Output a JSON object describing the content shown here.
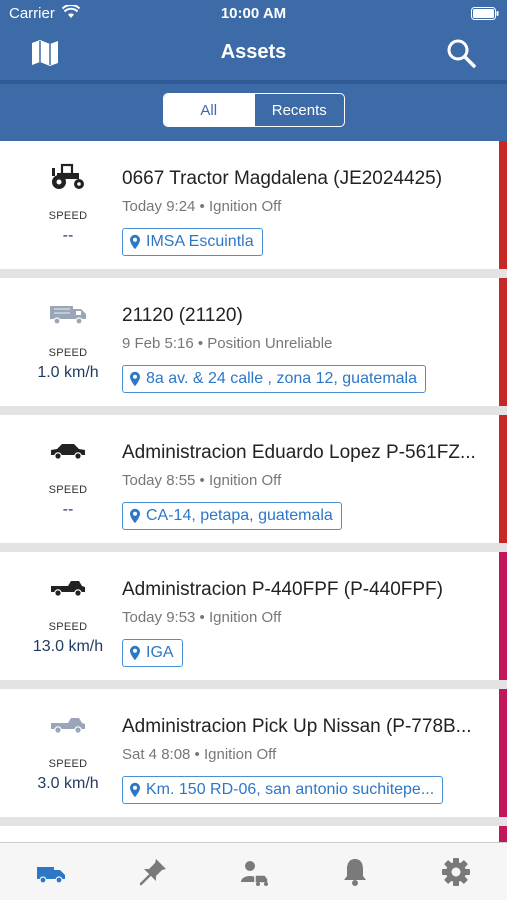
{
  "status_bar": {
    "carrier": "Carrier",
    "time": "10:00 AM"
  },
  "nav": {
    "title": "Assets"
  },
  "segments": {
    "all": "All",
    "recents": "Recents"
  },
  "colors": {
    "header": "#3d6ba8",
    "accent": "#2d77c7",
    "stripe_red": "#c62828",
    "stripe_pink": "#c2185b"
  },
  "assets": [
    {
      "icon": "tractor-icon",
      "speed_label": "SPEED",
      "speed": "--",
      "name": "0667 Tractor Magdalena (JE2024425)",
      "status": "Today 9:24 • Ignition Off",
      "location": "IMSA Escuintla"
    },
    {
      "icon": "truck-icon",
      "speed_label": "SPEED",
      "speed": "1.0 km/h",
      "name": "21120 (21120)",
      "status": "9 Feb 5:16 • Position Unreliable",
      "location": "8a av.  & 24 calle , zona 12,  guatemala"
    },
    {
      "icon": "car-icon",
      "speed_label": "SPEED",
      "speed": "--",
      "name": "Administracion Eduardo Lopez P-561FZ...",
      "status": "Today 8:55 • Ignition Off",
      "location": "CA-14, petapa,  guatemala"
    },
    {
      "icon": "pickup-icon",
      "speed_label": "SPEED",
      "speed": "13.0 km/h",
      "name": "Administracion P-440FPF (P-440FPF)",
      "status": "Today 9:53 • Ignition Off",
      "location": "IGA"
    },
    {
      "icon": "pickup-icon",
      "speed_label": "SPEED",
      "speed": "3.0 km/h",
      "name": "Administracion Pick Up Nissan (P-778B...",
      "status": "Sat 4 8:08 • Ignition Off",
      "location": "Km. 150 RD-06, san antonio suchitepe..."
    }
  ],
  "tabbar": [
    "assets-tab-icon",
    "pin-tab-icon",
    "driver-tab-icon",
    "bell-tab-icon",
    "gear-tab-icon"
  ]
}
